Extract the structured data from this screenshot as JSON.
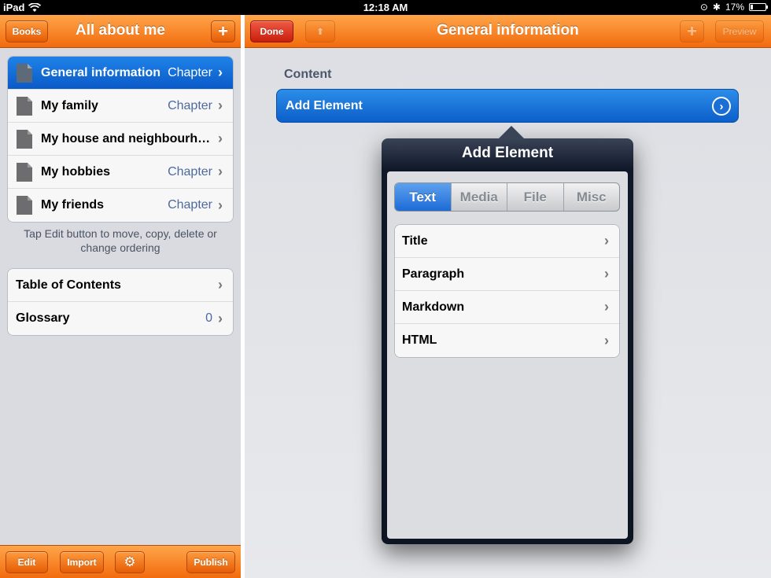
{
  "status_bar": {
    "device": "iPad",
    "time": "12:18 AM",
    "battery": "17%",
    "battery_level": 0.17
  },
  "left_pane": {
    "title": "All about me",
    "books_button": "Books",
    "add_button": "+",
    "chapters": [
      {
        "label": "General information",
        "detail": "Chapter",
        "selected": true
      },
      {
        "label": "My family",
        "detail": "Chapter"
      },
      {
        "label": "My house and neighbourhood",
        "detail": ""
      },
      {
        "label": "My hobbies",
        "detail": "Chapter"
      },
      {
        "label": "My friends",
        "detail": "Chapter"
      }
    ],
    "hint": "Tap Edit button to move, copy, delete or change ordering",
    "extras": [
      {
        "label": "Table of Contents",
        "detail": ""
      },
      {
        "label": "Glossary",
        "detail": "0"
      }
    ],
    "toolbar": {
      "edit": "Edit",
      "import": "Import",
      "publish": "Publish"
    }
  },
  "right_pane": {
    "title": "General information",
    "done_button": "Done",
    "add_button": "+",
    "preview_button": "Preview",
    "section_label": "Content",
    "add_element_row": "Add Element"
  },
  "popover": {
    "title": "Add Element",
    "tabs": [
      "Text",
      "Media",
      "File",
      "Misc"
    ],
    "active_tab": "Text",
    "items": [
      "Title",
      "Paragraph",
      "Markdown",
      "HTML"
    ]
  }
}
